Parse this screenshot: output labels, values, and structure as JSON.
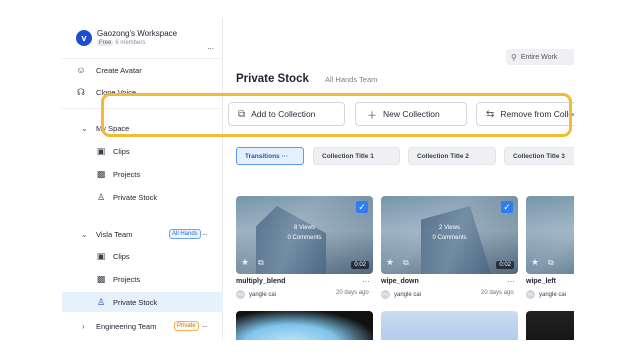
{
  "workspace": {
    "logo_letter": "v",
    "name": "Gaozong's Workspace",
    "plan": "Free",
    "members": "6 members",
    "more": "..."
  },
  "sidebar": {
    "top_items": [
      {
        "label": "Create Avatar",
        "icon": "avatar-icon"
      },
      {
        "label": "Clone Voice",
        "icon": "voice-icon"
      }
    ],
    "my_space": {
      "label": "My Space",
      "items": [
        {
          "label": "Clips",
          "icon": "clip-icon"
        },
        {
          "label": "Projects",
          "icon": "projects-icon"
        },
        {
          "label": "Private Stock",
          "icon": "private-stock-icon"
        }
      ]
    },
    "visla_team": {
      "label": "Visla Team",
      "tag": "All Hands",
      "more": "...",
      "items": [
        {
          "label": "Clips",
          "icon": "clip-icon"
        },
        {
          "label": "Projects",
          "icon": "projects-icon"
        },
        {
          "label": "Private Stock",
          "icon": "private-stock-icon",
          "active": true
        }
      ]
    },
    "engineering_team": {
      "label": "Engineering Team",
      "tag": "Private",
      "more": "..."
    }
  },
  "search": {
    "text": "Entire Work"
  },
  "header": {
    "title": "Private Stock",
    "subtitle": "All Hands Team"
  },
  "actions": {
    "add": "Add to Collection",
    "new": "New Collection",
    "remove": "Remove from Collection"
  },
  "chips": [
    {
      "label": "Transitions",
      "suffix": "···",
      "active": true
    },
    {
      "label": "Collection Title 1"
    },
    {
      "label": "Collection Title 2"
    },
    {
      "label": "Collection Title 3"
    }
  ],
  "cards": [
    {
      "name": "multiply_blend",
      "views": "8 Views",
      "comments": "0 Comments",
      "duration": "0:02",
      "user": "yangle cai",
      "avatar": "YC",
      "date": "20 days ago",
      "checked": true
    },
    {
      "name": "wipe_down",
      "views": "2 Views",
      "comments": "0 Comments",
      "duration": "0:02",
      "user": "yangle cai",
      "avatar": "YC",
      "date": "20 days ago",
      "checked": true
    },
    {
      "name": "wipe_left",
      "views": "",
      "comments": "",
      "duration": "",
      "user": "yangle cai",
      "avatar": "YC",
      "date": "",
      "checked": false
    }
  ],
  "colors": {
    "accent": "#2f7df0",
    "highlight": "#f1bb32",
    "active_nav": "#e7f1fd",
    "logo": "#1b4fcf"
  }
}
